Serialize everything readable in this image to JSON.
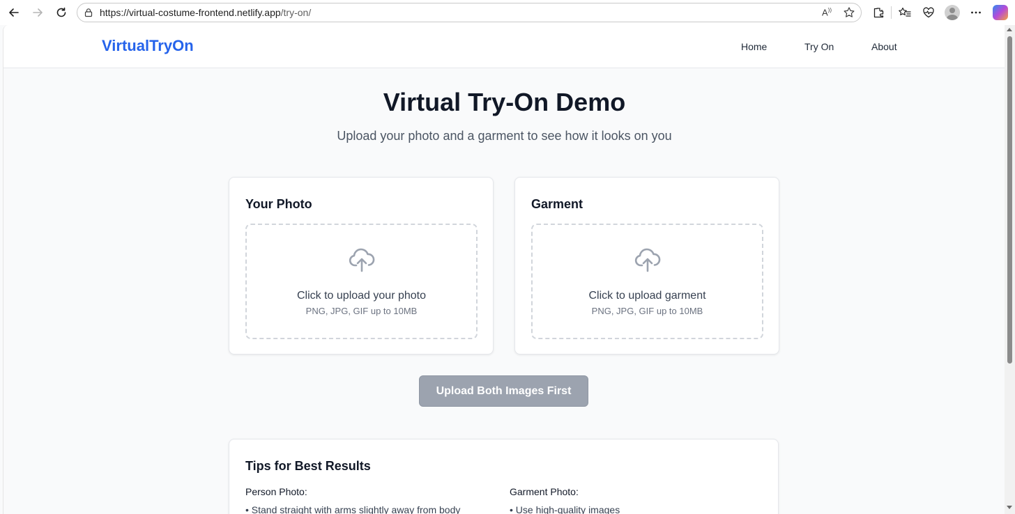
{
  "browser": {
    "url_domain": "https://virtual-costume-frontend.netlify.app",
    "url_path": "/try-on/"
  },
  "header": {
    "logo": "VirtualTryOn",
    "nav": [
      {
        "label": "Home"
      },
      {
        "label": "Try On"
      },
      {
        "label": "About"
      }
    ]
  },
  "hero": {
    "title": "Virtual Try-On Demo",
    "subtitle": "Upload your photo and a garment to see how it looks on you"
  },
  "uploads": [
    {
      "title": "Your Photo",
      "icon": "cloud-upload-icon",
      "prompt": "Click to upload your photo",
      "hint": "PNG, JPG, GIF up to 10MB"
    },
    {
      "title": "Garment",
      "icon": "cloud-upload-icon",
      "prompt": "Click to upload garment",
      "hint": "PNG, JPG, GIF up to 10MB"
    }
  ],
  "submit": {
    "label": "Upload Both Images First",
    "disabled": true
  },
  "tips": {
    "title": "Tips for Best Results",
    "person": {
      "title": "Person Photo:",
      "items": [
        "• Stand straight with arms slightly away from body"
      ]
    },
    "garment": {
      "title": "Garment Photo:",
      "items": [
        "• Use high-quality images"
      ]
    }
  },
  "colors": {
    "brand": "#2563eb",
    "disabled_button": "#9ca3af",
    "background": "#f9fafb"
  }
}
